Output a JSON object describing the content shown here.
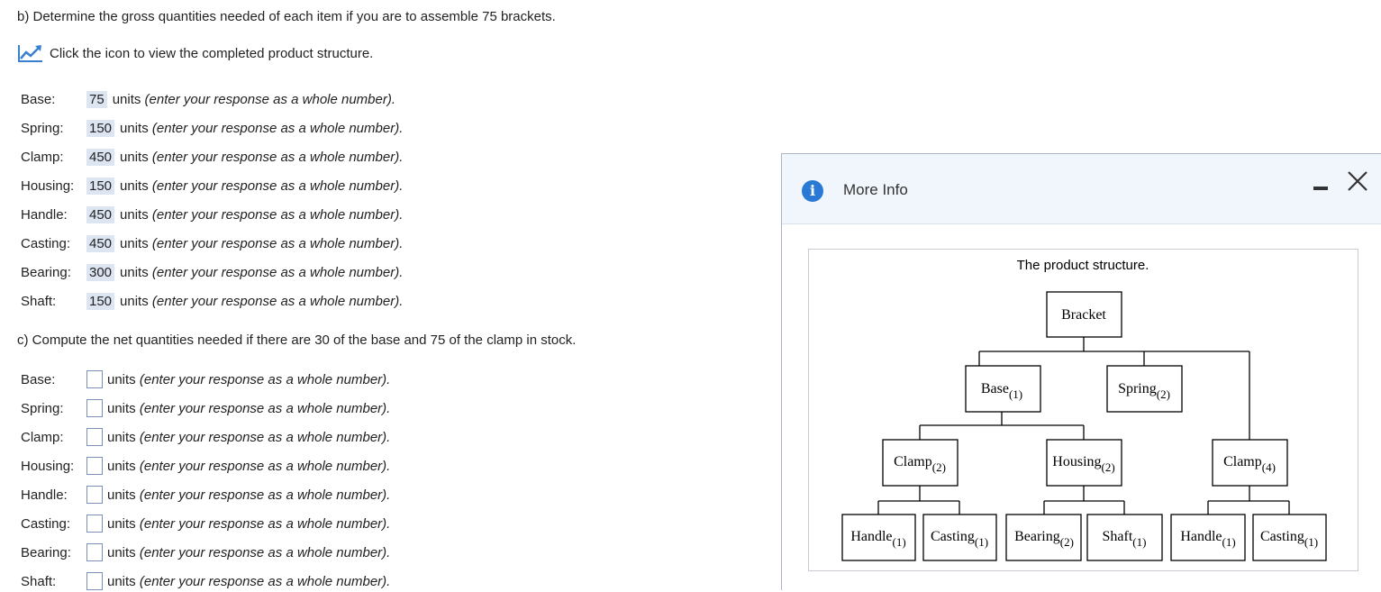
{
  "question_b": "b) Determine the gross quantities needed of each item if you are to assemble 75 brackets.",
  "hint_text": "Click the icon to view the completed product structure.",
  "units_word": "units",
  "response_hint": "(enter your response as a whole number).",
  "gross": [
    {
      "label": "Base:",
      "value": "75"
    },
    {
      "label": "Spring:",
      "value": "150"
    },
    {
      "label": "Clamp:",
      "value": "450"
    },
    {
      "label": "Housing:",
      "value": "150"
    },
    {
      "label": "Handle:",
      "value": "450"
    },
    {
      "label": "Casting:",
      "value": "450"
    },
    {
      "label": "Bearing:",
      "value": "300"
    },
    {
      "label": "Shaft:",
      "value": "150"
    }
  ],
  "question_c": "c) Compute the net quantities needed if there are 30 of the base and 75 of the clamp in stock.",
  "net": [
    {
      "label": "Base:",
      "value": ""
    },
    {
      "label": "Spring:",
      "value": ""
    },
    {
      "label": "Clamp:",
      "value": ""
    },
    {
      "label": "Housing:",
      "value": ""
    },
    {
      "label": "Handle:",
      "value": ""
    },
    {
      "label": "Casting:",
      "value": ""
    },
    {
      "label": "Bearing:",
      "value": ""
    },
    {
      "label": "Shaft:",
      "value": ""
    }
  ],
  "modal": {
    "title": "More Info",
    "info_icon": "i",
    "diagram_title": "The product structure.",
    "nodes": {
      "bracket": {
        "name": "Bracket",
        "qty": ""
      },
      "base": {
        "name": "Base",
        "qty": "(1)"
      },
      "spring": {
        "name": "Spring",
        "qty": "(2)"
      },
      "clamp_a": {
        "name": "Clamp",
        "qty": "(2)"
      },
      "housing": {
        "name": "Housing",
        "qty": "(2)"
      },
      "clamp_b": {
        "name": "Clamp",
        "qty": "(4)"
      },
      "handle_a": {
        "name": "Handle",
        "qty": "(1)"
      },
      "casting_a": {
        "name": "Casting",
        "qty": "(1)"
      },
      "bearing": {
        "name": "Bearing",
        "qty": "(2)"
      },
      "shaft": {
        "name": "Shaft",
        "qty": "(1)"
      },
      "handle_b": {
        "name": "Handle",
        "qty": "(1)"
      },
      "casting_b": {
        "name": "Casting",
        "qty": "(1)"
      }
    }
  },
  "colors": {
    "accent": "#2a7ad5",
    "value_bg": "#dde5f2",
    "modal_header_bg": "#f1f6fc"
  }
}
